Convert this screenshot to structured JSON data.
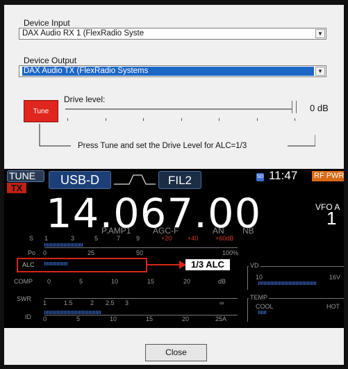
{
  "dialog": {
    "device_input_label": "Device Input",
    "device_input_value": "DAX Audio RX 1 (FlexRadio Syste",
    "device_output_label": "Device Output",
    "device_output_value": "DAX Audio TX (FlexRadio Systems",
    "tune_label": "Tune",
    "drive_level_label": "Drive level:",
    "drive_level_value": "0 dB",
    "hint": "Press Tune and set the Drive Level for ALC=1/3",
    "close_label": "Close",
    "colors": {
      "tune_button": "#e0261e",
      "selection": "#1c66c6"
    }
  },
  "radio": {
    "tune_tag": "TUNE",
    "tx_tag": "TX",
    "mode": "USB-D",
    "filter": "FIL2",
    "sd_icon": "SD",
    "clock": "11:47",
    "rf_pwr": "RF PWR",
    "frequency": "14.067.00",
    "vfo_label": "VFO A",
    "vfo_digit": "1",
    "indicators": [
      "P.AMP1",
      "AGC-F",
      "AN",
      "NB"
    ],
    "s_scale": [
      "S",
      "1",
      "3",
      "5",
      "7",
      "9"
    ],
    "s_scale_red": [
      "+20",
      "+40",
      "+60dB"
    ],
    "po_label": "Po",
    "po_scale": [
      "0",
      "25",
      "50",
      "100%"
    ],
    "alc_label": "ALC",
    "alc_note": "1/3 ALC",
    "comp_label": "COMP",
    "comp_scale": [
      "0",
      "5",
      "10",
      "15",
      "20",
      "dB"
    ],
    "swr_label": "SWR",
    "swr_scale": [
      "1",
      "1.5",
      "2",
      "2.5",
      "3",
      "∞"
    ],
    "id_label": "ID",
    "id_scale": [
      "0",
      "5",
      "10",
      "15",
      "20",
      "25A"
    ],
    "vd_label": "VD",
    "vd_scale": [
      "10",
      "16V"
    ],
    "temp_label": "TEMP",
    "temp_scale": [
      "COOL",
      "HOT"
    ],
    "colors": {
      "meter": "#3b6fd8",
      "alc_highlight": "#d8261a",
      "rf_pwr": "#d86a15",
      "mode_box": "#1d3f78"
    }
  }
}
